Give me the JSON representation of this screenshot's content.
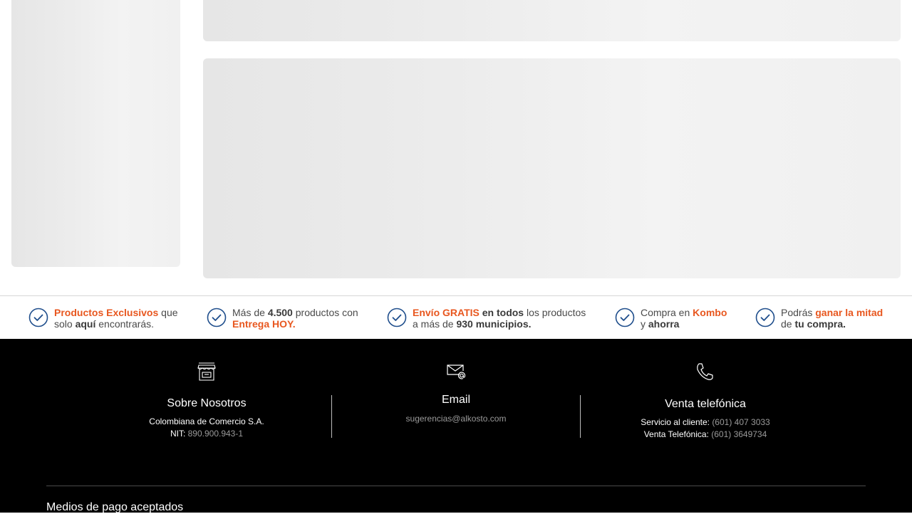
{
  "benefits": [
    {
      "icon": "check-circle-icon",
      "parts": [
        {
          "t": "Productos Exclusivos",
          "s": "hl"
        },
        {
          "t": " que",
          "s": ""
        },
        {
          "t": "\n",
          "s": "br"
        },
        {
          "t": "solo ",
          "s": ""
        },
        {
          "t": "aquí",
          "s": "b"
        },
        {
          "t": " encontrarás.",
          "s": ""
        }
      ]
    },
    {
      "icon": "check-circle-icon",
      "parts": [
        {
          "t": "Más de ",
          "s": ""
        },
        {
          "t": "4.500",
          "s": "b"
        },
        {
          "t": " productos con",
          "s": ""
        },
        {
          "t": "\n",
          "s": "br"
        },
        {
          "t": "Entrega HOY.",
          "s": "hl"
        }
      ]
    },
    {
      "icon": "check-circle-icon",
      "parts": [
        {
          "t": "Envío GRATIS",
          "s": "hl"
        },
        {
          "t": " ",
          "s": ""
        },
        {
          "t": "en todos",
          "s": "b"
        },
        {
          "t": " los productos",
          "s": ""
        },
        {
          "t": "\n",
          "s": "br"
        },
        {
          "t": "a más de ",
          "s": ""
        },
        {
          "t": "930 municipios.",
          "s": "b"
        }
      ]
    },
    {
      "icon": "check-circle-icon",
      "parts": [
        {
          "t": "Compra en ",
          "s": ""
        },
        {
          "t": "Kombo",
          "s": "hl"
        },
        {
          "t": "\n",
          "s": "br"
        },
        {
          "t": "y ",
          "s": ""
        },
        {
          "t": "ahorra",
          "s": "b"
        }
      ]
    },
    {
      "icon": "check-circle-icon",
      "parts": [
        {
          "t": "Podrás ",
          "s": ""
        },
        {
          "t": "ganar la mitad",
          "s": "hl"
        },
        {
          "t": "\n",
          "s": "br"
        },
        {
          "t": "de ",
          "s": ""
        },
        {
          "t": "tu compra.",
          "s": "b"
        }
      ]
    }
  ],
  "footer": {
    "about": {
      "icon": "store-icon",
      "title": "Sobre Nosotros",
      "company": "Colombiana de Comercio S.A.",
      "nit_label": "NIT: ",
      "nit_value": "890.900.943-1"
    },
    "email": {
      "icon": "mail-at-icon",
      "title": "Email",
      "address": "sugerencias@alkosto.com"
    },
    "phone": {
      "icon": "phone-icon",
      "title": "Venta telefónica",
      "service_label": "Servicio al cliente: ",
      "service_value": "(601) 407 3033",
      "sales_label": "Venta Telefónica: ",
      "sales_value": "(601) 3649734"
    },
    "payments_title": "Medios de pago aceptados"
  },
  "colors": {
    "accent": "#e8571f",
    "check": "#1f4e8c",
    "footer_bg": "#000000"
  }
}
